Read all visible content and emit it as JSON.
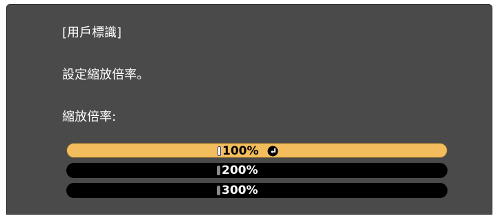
{
  "header": {
    "title": "[用戶標識]"
  },
  "content": {
    "instruction": "設定縮放倍率。",
    "scale_label": "縮放倍率:"
  },
  "options": [
    {
      "label": "100%",
      "selected": true
    },
    {
      "label": "200%",
      "selected": false
    },
    {
      "label": "300%",
      "selected": false
    }
  ],
  "icons": {
    "confirm": "enter-icon"
  },
  "colors": {
    "panel_background": "#4a4a4a",
    "selected_option": "#f3bd5d",
    "unselected_option": "#000000",
    "text": "#ffffff"
  }
}
